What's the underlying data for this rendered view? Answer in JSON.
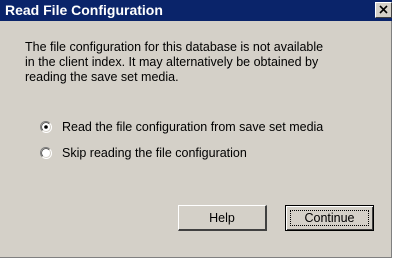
{
  "window": {
    "title": "Read File Configuration",
    "close_icon": "close-icon"
  },
  "message": {
    "lines": [
      "The file configuration for this database is not available",
      "in the client index.  It may alternatively be obtained by",
      "reading the save set media."
    ]
  },
  "options": [
    {
      "label": "Read the file configuration from save set media",
      "selected": true
    },
    {
      "label": "Skip reading the file configuration",
      "selected": false
    }
  ],
  "buttons": {
    "help": "Help",
    "continue": "Continue"
  },
  "colors": {
    "titlebar": "#0a246a",
    "dialog_face": "#d4d0c8"
  }
}
